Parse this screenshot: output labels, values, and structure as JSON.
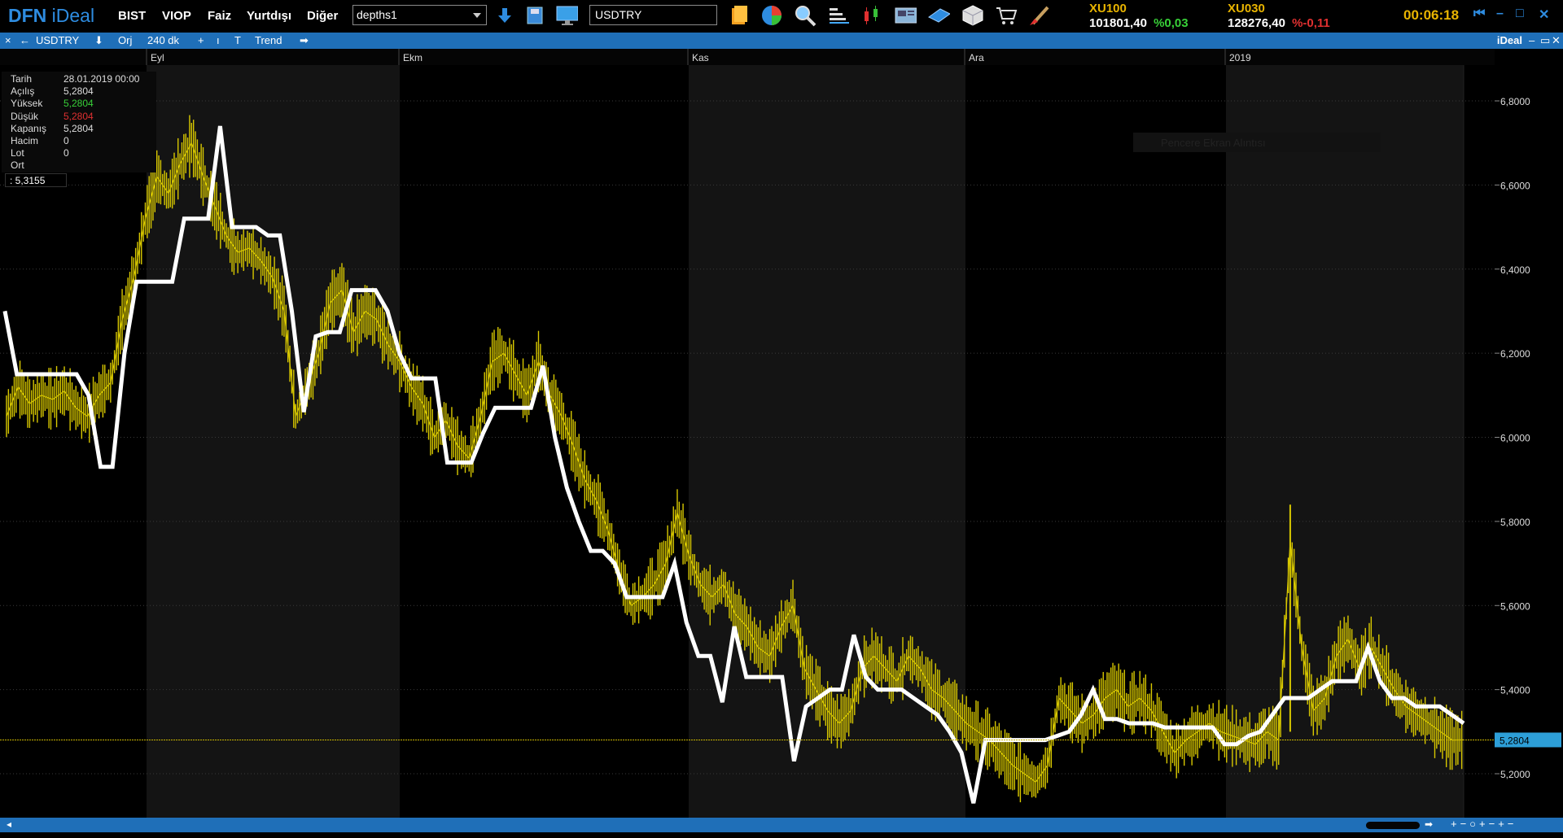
{
  "app": {
    "logo_dfn": "DFN",
    "logo_ideal": "iDeal",
    "menu": [
      "BIST",
      "VIOP",
      "Faiz",
      "Yurtdışı",
      "Diğer"
    ],
    "workspace_select": "depths1",
    "symbol_input": "USDTRY",
    "clock": "00:06:18",
    "tickers": [
      {
        "name": "XU100",
        "value": "101801,40",
        "change": "%0,03",
        "direction": "up"
      },
      {
        "name": "XU030",
        "value": "128276,40",
        "change": "%-0,11",
        "direction": "down"
      }
    ],
    "toolbar_icons": [
      "download-arrow-icon",
      "save-disk-icon",
      "monitor-icon",
      "notes-icon",
      "pie-chart-icon",
      "search-icon",
      "bar-list-icon",
      "candlestick-icon",
      "news-icon",
      "book-icon",
      "cube-icon",
      "cart-icon",
      "brush-icon"
    ]
  },
  "chart_toolbar": {
    "close": "×",
    "back": "←",
    "symbol": "USDTRY",
    "download": "⬇",
    "orj": "Orj",
    "period": "240 dk",
    "plus": "+",
    "bar_icon": "ı",
    "t_icon": "T",
    "trend": "Trend",
    "forward": "➡",
    "brand": "iDeal",
    "window_controls": [
      "–",
      "▭",
      "✕"
    ]
  },
  "info_box": {
    "rows": [
      {
        "label": "Tarih",
        "value": "28.01.2019 00:00",
        "color": "#dddddd"
      },
      {
        "label": "Açılış",
        "value": "5,2804",
        "color": "#dddddd"
      },
      {
        "label": "Yüksek",
        "value": "5,2804",
        "color": "#38d038"
      },
      {
        "label": "Düşük",
        "value": "5,2804",
        "color": "#e03030"
      },
      {
        "label": "Kapanış",
        "value": "5,2804",
        "color": "#dddddd"
      },
      {
        "label": "Hacim",
        "value": "0",
        "color": "#dddddd"
      },
      {
        "label": "Lot",
        "value": "0",
        "color": "#dddddd"
      },
      {
        "label": "Ort",
        "value": "",
        "color": "#dddddd"
      }
    ],
    "cursor_price": ": 5,3155"
  },
  "faint_popup": "Pencere Ekran Alıntısı",
  "chart_data": {
    "type": "line",
    "symbol": "USDTRY",
    "period": "240 dk",
    "x_labels": [
      "Eyl",
      "Ekm",
      "Kas",
      "Ara",
      "2019"
    ],
    "y_ticks": [
      "6,8000",
      "6,6000",
      "6,4000",
      "6,2000",
      "6,0000",
      "5,8000",
      "5,6000",
      "5,4000",
      "5,2000"
    ],
    "ylim": [
      5.15,
      6.88
    ],
    "last_price": "5,2804",
    "last_price_value": 5.2804,
    "colors": {
      "price": "#d8c800",
      "trend": "#ffffff",
      "last": "#c8b400",
      "tag": "#2d9fd8"
    },
    "series": [
      {
        "name": "Price",
        "values": [
          6.05,
          6.12,
          6.08,
          6.1,
          6.09,
          6.11,
          6.07,
          6.05,
          6.1,
          6.13,
          6.28,
          6.38,
          6.52,
          6.62,
          6.58,
          6.65,
          6.7,
          6.62,
          6.55,
          6.48,
          6.44,
          6.45,
          6.42,
          6.38,
          6.3,
          6.05,
          6.12,
          6.2,
          6.32,
          6.35,
          6.25,
          6.3,
          6.28,
          6.22,
          6.18,
          6.12,
          6.08,
          6.0,
          6.04,
          5.98,
          5.95,
          6.05,
          6.18,
          6.2,
          6.15,
          6.1,
          6.18,
          6.1,
          6.05,
          5.98,
          5.9,
          5.85,
          5.78,
          5.68,
          5.6,
          5.62,
          5.65,
          5.7,
          5.82,
          5.72,
          5.65,
          5.62,
          5.65,
          5.58,
          5.55,
          5.5,
          5.48,
          5.55,
          5.6,
          5.45,
          5.4,
          5.35,
          5.32,
          5.35,
          5.45,
          5.48,
          5.45,
          5.42,
          5.48,
          5.45,
          5.4,
          5.38,
          5.35,
          5.32,
          5.3,
          5.28,
          5.25,
          5.22,
          5.2,
          5.18,
          5.22,
          5.38,
          5.35,
          5.32,
          5.34,
          5.38,
          5.4,
          5.36,
          5.38,
          5.35,
          5.3,
          5.25,
          5.28,
          5.3,
          5.32,
          5.3,
          5.29,
          5.28,
          5.27,
          5.3,
          5.28,
          5.75,
          5.5,
          5.35,
          5.38,
          5.48,
          5.52,
          5.45,
          5.5,
          5.45,
          5.4,
          5.36,
          5.34,
          5.32,
          5.3,
          5.28,
          5.2804
        ]
      },
      {
        "name": "Trend",
        "values": [
          6.3,
          6.15,
          6.15,
          6.15,
          6.15,
          6.15,
          6.15,
          6.1,
          5.93,
          5.93,
          6.2,
          6.37,
          6.37,
          6.37,
          6.37,
          6.52,
          6.52,
          6.52,
          6.74,
          6.5,
          6.5,
          6.5,
          6.48,
          6.48,
          6.3,
          6.06,
          6.24,
          6.25,
          6.25,
          6.35,
          6.35,
          6.35,
          6.3,
          6.2,
          6.14,
          6.14,
          6.14,
          5.94,
          5.94,
          5.94,
          6.01,
          6.07,
          6.07,
          6.07,
          6.07,
          6.17,
          6.0,
          5.88,
          5.8,
          5.73,
          5.73,
          5.7,
          5.62,
          5.62,
          5.62,
          5.62,
          5.7,
          5.56,
          5.48,
          5.48,
          5.37,
          5.55,
          5.43,
          5.43,
          5.43,
          5.43,
          5.23,
          5.36,
          5.38,
          5.4,
          5.4,
          5.53,
          5.43,
          5.4,
          5.4,
          5.4,
          5.38,
          5.36,
          5.34,
          5.3,
          5.25,
          5.13,
          5.28,
          5.28,
          5.28,
          5.28,
          5.28,
          5.28,
          5.29,
          5.3,
          5.34,
          5.4,
          5.33,
          5.33,
          5.32,
          5.32,
          5.32,
          5.31,
          5.31,
          5.31,
          5.31,
          5.31,
          5.27,
          5.27,
          5.29,
          5.3,
          5.34,
          5.38,
          5.38,
          5.38,
          5.4,
          5.42,
          5.42,
          5.42,
          5.5,
          5.42,
          5.38,
          5.38,
          5.36,
          5.36,
          5.36,
          5.34,
          5.32
        ]
      }
    ]
  }
}
